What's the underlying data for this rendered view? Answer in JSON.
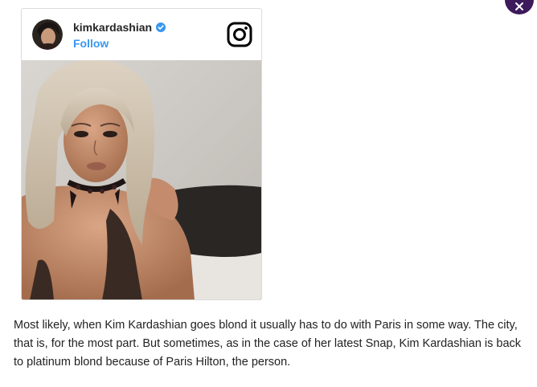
{
  "embed": {
    "username": "kimkardashian",
    "follow_label": "Follow",
    "avatar_icon": "profile-avatar",
    "verified_icon": "verified-badge-icon",
    "platform_icon": "instagram-icon",
    "accent_color": "#3897f0"
  },
  "article": {
    "paragraph": "Most likely, when Kim Kardashian goes blond it usually has to do with Paris in some way. The city, that is, for the most part. But sometimes, as in the case of her latest Snap, Kim Kardashian is back to platinum blond because of Paris Hilton, the person."
  },
  "close_button": {
    "icon": "close-icon",
    "color": "#3d1a5b"
  }
}
